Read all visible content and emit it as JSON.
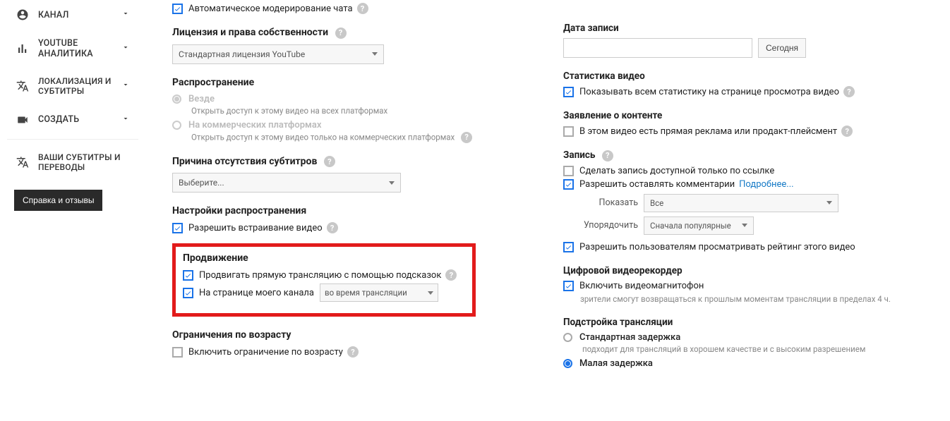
{
  "sidebar": {
    "items": [
      {
        "label": "КАНАЛ"
      },
      {
        "label": "YOUTUBE АНАЛИТИКА"
      },
      {
        "label": "ЛОКАЛИЗАЦИЯ И СУБТИТРЫ"
      },
      {
        "label": "СОЗДАТЬ"
      },
      {
        "label": "ВАШИ СУБТИТРЫ И ПЕРЕВОДЫ"
      }
    ],
    "feedback_button": "Справка и отзывы"
  },
  "left": {
    "auto_moderation": "Автоматическое модерирование чата",
    "license_heading": "Лицензия и права собственности",
    "license_value": "Стандартная лицензия YouTube",
    "distribution_heading": "Распространение",
    "dist_everywhere": "Везде",
    "dist_everywhere_desc": "Открыть доступ к этому видео на всех платформах",
    "dist_commercial": "На коммерческих платформах",
    "dist_commercial_desc": "Открыть доступ к этому видео только на коммерческих платформах",
    "no_captions_heading": "Причина отсутствия субтитров",
    "no_captions_value": "Выберите...",
    "dist_settings_heading": "Настройки распространения",
    "allow_embed": "Разрешить встраивание видео",
    "promotion_heading": "Продвижение",
    "promote_hints": "Продвигать прямую трансляцию с помощью подсказок",
    "on_channel_page": "На странице моего канала",
    "promote_select_value": "во время трансляции",
    "age_heading": "Ограничения по возрасту",
    "age_enable": "Включить ограничение по возрасту"
  },
  "right": {
    "date_heading": "Дата записи",
    "today_btn": "Сегодня",
    "stats_heading": "Статистика видео",
    "stats_show": "Показывать всем статистику на странице просмотра видео",
    "content_decl_heading": "Заявление о контенте",
    "content_decl_cb": "В этом видео есть прямая реклама или продакт-плейсмент",
    "recording_heading": "Запись",
    "rec_link_only": "Сделать запись доступной только по ссылке",
    "rec_allow_comments": "Разрешить оставлять комментарии",
    "rec_more": "Подробнее...",
    "show_label": "Показать",
    "show_value": "Все",
    "sort_label": "Упорядочить",
    "sort_value": "Сначала популярные",
    "allow_rating": "Разрешить пользователям просматривать рейтинг этого видео",
    "dvr_heading": "Цифровой видеорекордер",
    "dvr_enable": "Включить видеомагнитофон",
    "dvr_desc": "зрители смогут возвращаться к прошлым моментам трансляции в пределах 4 ч.",
    "latency_heading": "Подстройка трансляции",
    "latency_std": "Стандартная задержка",
    "latency_std_desc": "подходит для трансляций в хорошем качестве и с высоким разрешением",
    "latency_low": "Малая задержка"
  }
}
